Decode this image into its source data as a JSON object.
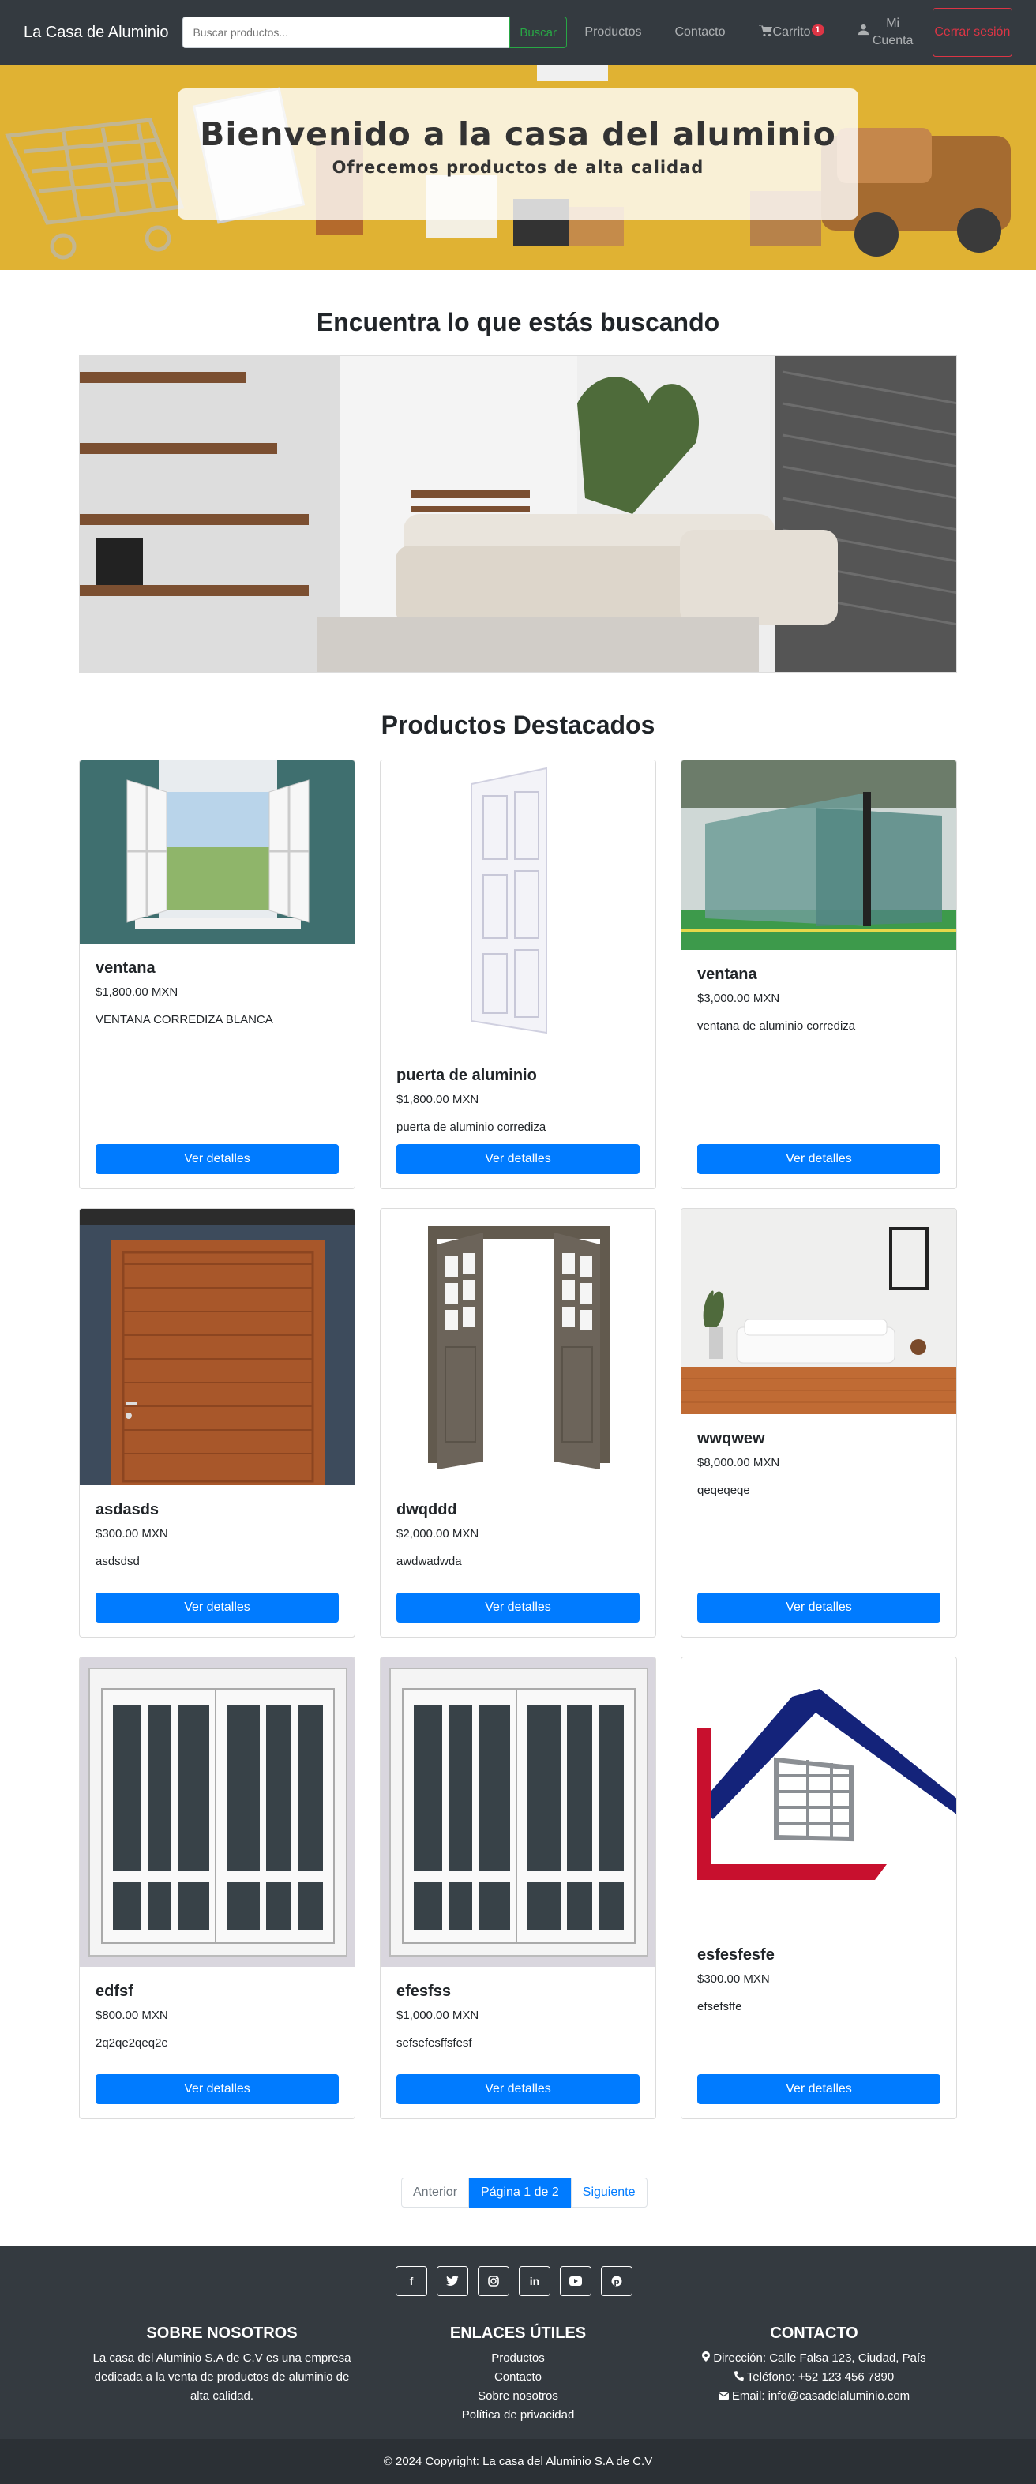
{
  "navbar": {
    "brand": "La Casa de Aluminio",
    "search_placeholder": "Buscar productos...",
    "search_button": "Buscar",
    "links": {
      "products": "Productos",
      "contact": "Contacto",
      "cart": "Carrito",
      "cart_count": "1",
      "account": "Mi Cuenta"
    },
    "logout": "Cerrar sesión"
  },
  "hero": {
    "title": "Bienvenido a la casa del aluminio",
    "subtitle": "Ofrecemos productos de alta calidad"
  },
  "find_section": {
    "title": "Encuentra lo que estás buscando"
  },
  "featured": {
    "title": "Productos Destacados",
    "button_label": "Ver detalles",
    "products": [
      {
        "name": "ventana",
        "price": "$1,800.00 MXN",
        "description": "VENTANA CORREDIZA BLANCA",
        "image_icon": "open-window-image"
      },
      {
        "name": "puerta de aluminio",
        "price": "$1,800.00 MXN",
        "description": "puerta de aluminio corrediza",
        "image_icon": "white-door-image"
      },
      {
        "name": "ventana",
        "price": "$3,000.00 MXN",
        "description": "ventana de aluminio corrediza",
        "image_icon": "glass-warehouse-image"
      },
      {
        "name": "asdasds",
        "price": "$300.00 MXN",
        "description": "asdsdsd",
        "image_icon": "wood-door-image"
      },
      {
        "name": "dwqddd",
        "price": "$2,000.00 MXN",
        "description": "awdwadwda",
        "image_icon": "double-door-image"
      },
      {
        "name": "wwqwew",
        "price": "$8,000.00 MXN",
        "description": "qeqeqeqe",
        "image_icon": "living-room-image"
      },
      {
        "name": "edfsf",
        "price": "$800.00 MXN",
        "description": "2q2qe2qeq2e",
        "image_icon": "sliding-window-image"
      },
      {
        "name": "efesfss",
        "price": "$1,000.00 MXN",
        "description": "sefsefesffsfesf",
        "image_icon": "sliding-window-image"
      },
      {
        "name": "esfesfesfe",
        "price": "$300.00 MXN",
        "description": "efsefsffe",
        "image_icon": "house-logo-image"
      }
    ]
  },
  "pagination": {
    "prev": "Anterior",
    "current": "Página 1 de 2",
    "next": "Siguiente"
  },
  "footer": {
    "socials": [
      "facebook-icon",
      "twitter-icon",
      "instagram-icon",
      "linkedin-icon",
      "youtube-icon",
      "pinterest-icon"
    ],
    "about": {
      "title": "SOBRE NOSOTROS",
      "text": "La casa del Aluminio S.A de C.V es una empresa dedicada a la venta de productos de aluminio de alta calidad."
    },
    "links": {
      "title": "ENLACES ÚTILES",
      "items": [
        "Productos",
        "Contacto",
        "Sobre nosotros",
        "Política de privacidad"
      ]
    },
    "contact": {
      "title": "CONTACTO",
      "address": "Dirección: Calle Falsa 123, Ciudad, País",
      "phone": "Teléfono: +52 123 456 7890",
      "email": "Email: info@casadelaluminio.com"
    },
    "copyright": "© 2024 Copyright: La casa del Aluminio S.A de C.V"
  },
  "colors": {
    "navbar_bg": "#343a40",
    "primary": "#007bff",
    "success": "#28a745",
    "danger": "#dc3545"
  }
}
